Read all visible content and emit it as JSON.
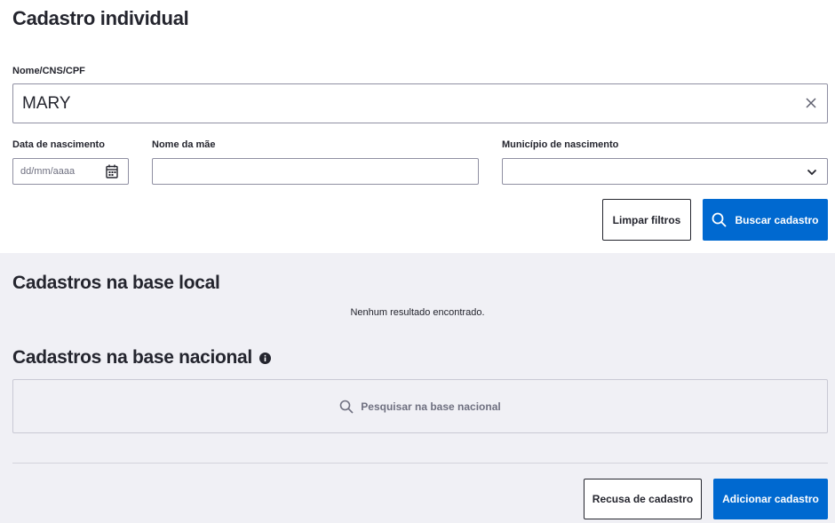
{
  "page": {
    "title": "Cadastro individual"
  },
  "filters": {
    "name_label": "Nome/CNS/CPF",
    "name_value": "MARY",
    "birth_label": "Data de nascimento",
    "birth_placeholder": "dd/mm/aaaa",
    "mother_label": "Nome da mãe",
    "mother_value": "",
    "city_label": "Município de nascimento",
    "city_value": ""
  },
  "actions": {
    "clear_label": "Limpar filtros",
    "search_label": "Buscar cadastro"
  },
  "local": {
    "title": "Cadastros na base local",
    "empty_message": "Nenhum resultado encontrado."
  },
  "national": {
    "title": "Cadastros na base nacional",
    "search_label": "Pesquisar na base nacional"
  },
  "footer": {
    "refuse_label": "Recusa de cadastro",
    "add_label": "Adicionar cadastro"
  },
  "colors": {
    "primary": "#0069d0",
    "section_bg": "#f0f0f5",
    "text": "#24252e"
  }
}
